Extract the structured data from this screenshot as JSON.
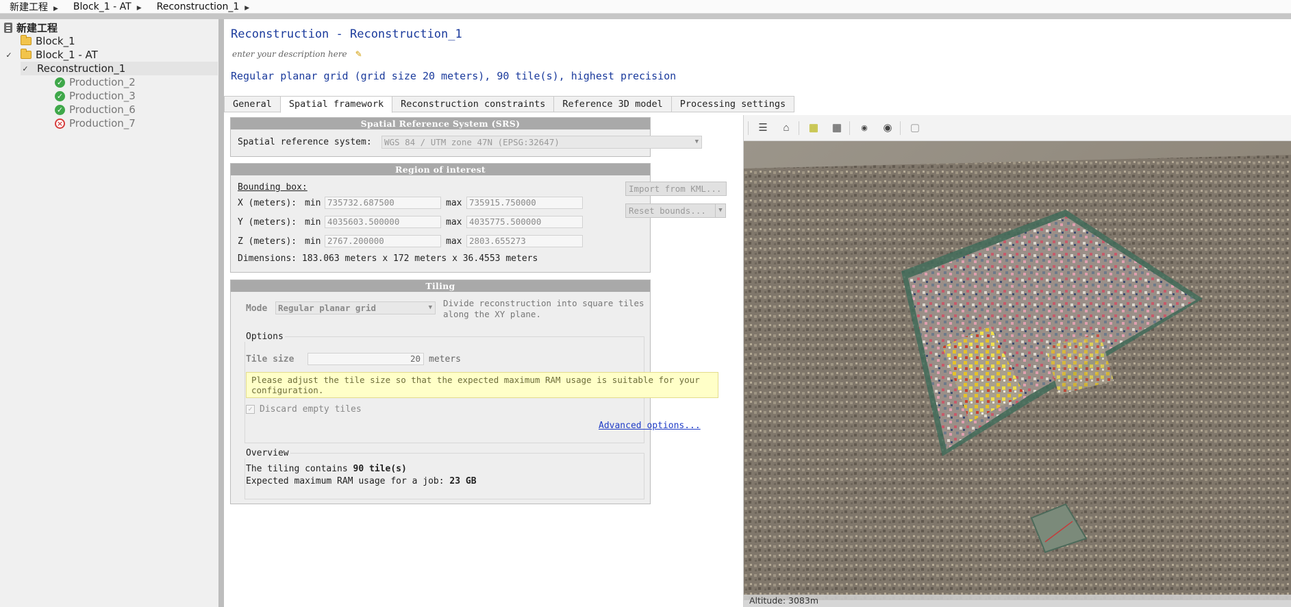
{
  "breadcrumb": [
    "新建工程",
    "Block_1 - AT",
    "Reconstruction_1"
  ],
  "tree": {
    "project": "新建工程",
    "block1": "Block_1",
    "block1at": "Block_1 - AT",
    "reconstruction": "Reconstruction_1",
    "productions": [
      {
        "label": "Production_2",
        "status": "ok"
      },
      {
        "label": "Production_3",
        "status": "ok"
      },
      {
        "label": "Production_6",
        "status": "ok"
      },
      {
        "label": "Production_7",
        "status": "error"
      }
    ]
  },
  "header": {
    "title": "Reconstruction - Reconstruction_1",
    "description_placeholder": "enter your description here",
    "summary": "Regular planar grid (grid size 20 meters), 90 tile(s), highest precision"
  },
  "tabs": [
    "General",
    "Spatial framework",
    "Reconstruction constraints",
    "Reference 3D model",
    "Processing settings"
  ],
  "active_tab": "Spatial framework",
  "srs": {
    "heading": "Spatial Reference System (SRS)",
    "label": "Spatial reference system:",
    "value": "WGS 84 / UTM zone 47N (EPSG:32647)"
  },
  "roi": {
    "heading": "Region of interest",
    "bbox_label": "Bounding box:",
    "rows": [
      {
        "label": "X (meters):",
        "min_label": "min",
        "min": "735732.687500",
        "max_label": "max",
        "max": "735915.750000"
      },
      {
        "label": "Y (meters):",
        "min_label": "min",
        "min": "4035603.500000",
        "max_label": "max",
        "max": "4035775.500000"
      },
      {
        "label": "Z (meters):",
        "min_label": "min",
        "min": "2767.200000",
        "max_label": "max",
        "max": "2803.655273"
      }
    ],
    "import_kml": "Import from KML...",
    "reset_bounds": "Reset bounds...",
    "dimensions": "Dimensions: 183.063 meters x 172 meters x 36.4553 meters"
  },
  "tiling": {
    "heading": "Tiling",
    "mode_label": "Mode",
    "mode_value": "Regular planar grid",
    "mode_desc": "Divide reconstruction into square tiles along the XY plane.",
    "options_label": "Options",
    "tile_size_label": "Tile size",
    "tile_size_value": "20",
    "tile_size_unit": "meters",
    "warning": "Please adjust the tile size so that the expected maximum RAM usage is suitable for your configuration.",
    "discard_label": "Discard empty tiles",
    "discard_checked": true,
    "advanced": "Advanced options...",
    "overview_label": "Overview",
    "overview_line1_prefix": "The tiling contains ",
    "overview_line1_value": "90 tile(s)",
    "overview_line2_prefix": "Expected maximum RAM usage for a job: ",
    "overview_line2_value": "23 GB"
  },
  "viewer": {
    "status": "Altitude: 3083m",
    "tools": [
      "layers-icon",
      "home-icon",
      "cube-icon",
      "grid-icon",
      "camera-small-icon",
      "camera-icon",
      "box-outline-icon"
    ]
  }
}
